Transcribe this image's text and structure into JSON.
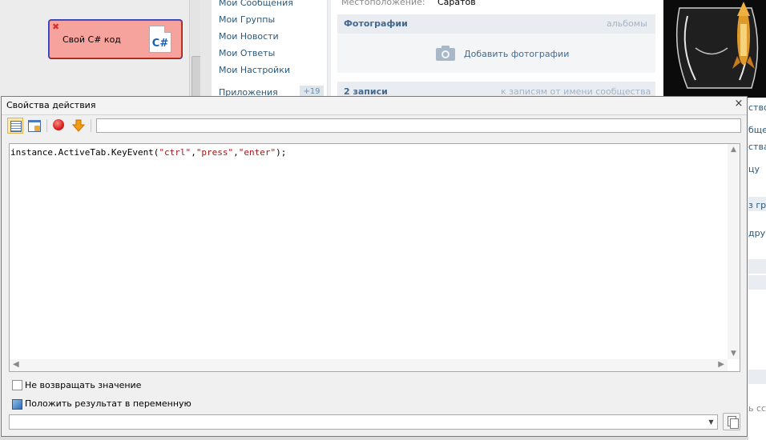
{
  "background": {
    "action_block": {
      "label": "Свой C# код",
      "icon_text": "C#"
    },
    "vk_nav": {
      "items": [
        "Мои Сообщения",
        "Мои Группы",
        "Мои Новости",
        "Мои Ответы",
        "Мои Настройки",
        "Приложения"
      ],
      "apps_badge": "+19"
    },
    "vk_profile": {
      "location_label": "Местоположение:",
      "location_value": "Саратов",
      "photos_title": "Фотографии",
      "photos_albums_link": "альбомы",
      "photos_add": "Добавить фотографии",
      "posts_count": "2 записи",
      "posts_link": "к записям от имени сообщества"
    },
    "right_fragments": [
      "ство",
      "бще",
      "ства",
      "цу",
      "з гру",
      "дру",
      "ь ссы"
    ]
  },
  "dialog": {
    "title": "Свойства действия",
    "close_glyph": "×",
    "toolbar": {
      "input_value": ""
    },
    "code": {
      "prefix": "instance.ActiveTab.KeyEvent(",
      "arg1": "\"ctrl\"",
      "comma": ",",
      "arg2": "\"press\"",
      "arg3": "\"enter\"",
      "suffix": ");"
    },
    "options": {
      "no_return_label": "Не возвращать значение",
      "no_return_checked": false,
      "put_result_label": "Положить результат в переменную",
      "variable_value": ""
    }
  },
  "colors": {
    "action_block_bg": "#f6a39d",
    "vk_link": "#2b587a",
    "vk_header": "#45688e",
    "code_string": "#a31515"
  }
}
